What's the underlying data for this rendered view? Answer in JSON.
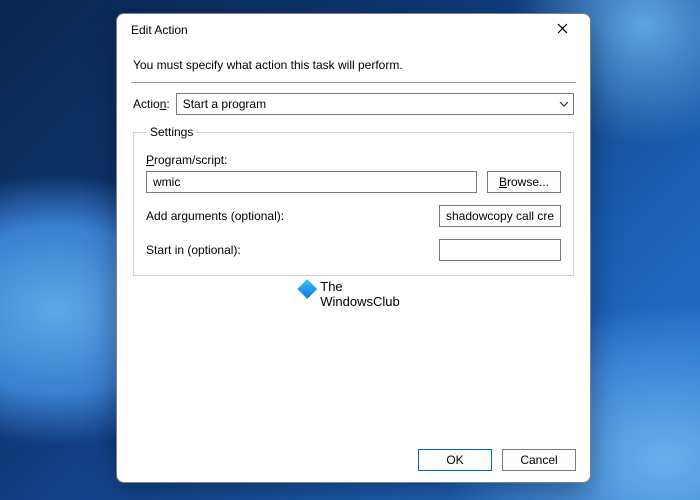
{
  "dialog": {
    "title": "Edit Action",
    "description": "You must specify what action this task will perform.",
    "action_label_pre": "Actio",
    "action_label_ul": "n",
    "action_label_post": ":",
    "action_value": "Start a program",
    "settings": {
      "legend": "Settings",
      "program_label_ul": "P",
      "program_label_rest": "rogram/script:",
      "program_value": "wmic",
      "browse_ul": "B",
      "browse_rest": "rowse...",
      "args_label_ul": "A",
      "args_label_rest": "dd arguments (optional):",
      "args_value": "shadowcopy call create \\",
      "start_in_pre": "S",
      "start_in_ul": "t",
      "start_in_post": "art in (optional):",
      "start_in_value": ""
    },
    "ok": "OK",
    "cancel": "Cancel"
  },
  "watermark": {
    "line1": "The",
    "line2": "WindowsClub"
  }
}
